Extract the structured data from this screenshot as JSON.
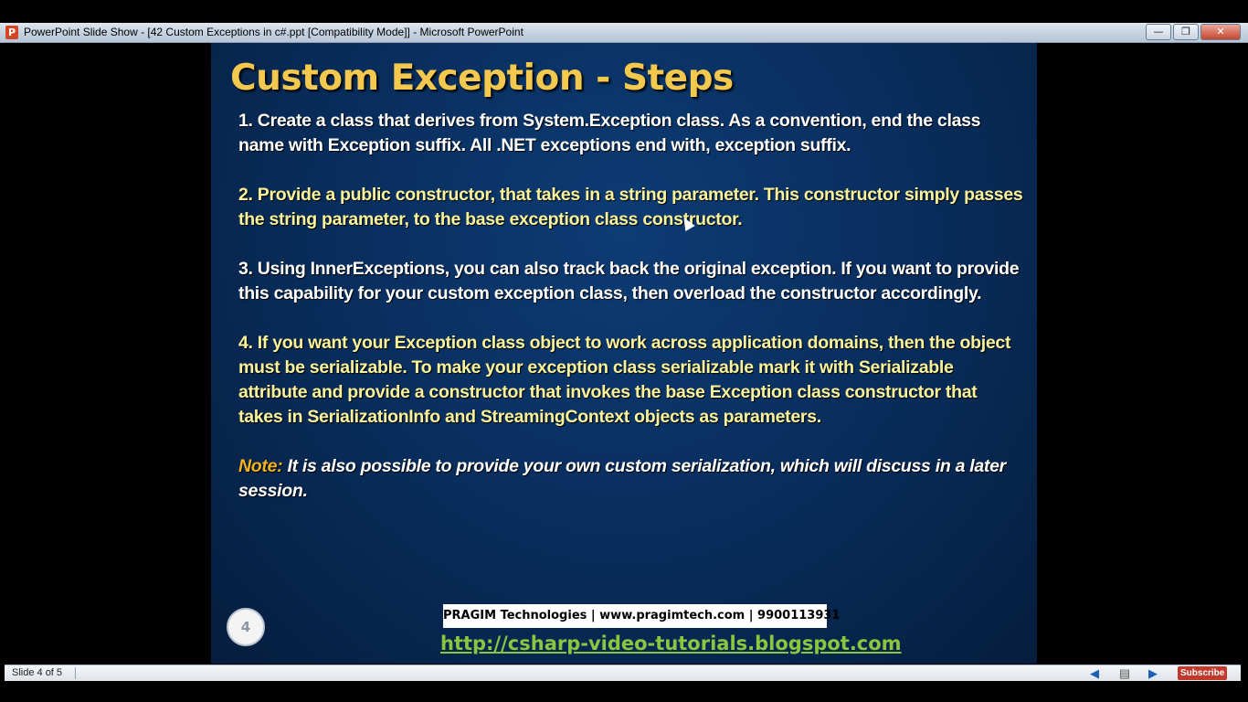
{
  "window": {
    "app_icon": "powerpoint-icon",
    "title": "PowerPoint Slide Show - [42 Custom Exceptions in c#.ppt [Compatibility Mode]] - Microsoft PowerPoint",
    "buttons": [
      "minimize-icon",
      "restore-icon",
      "close-icon"
    ]
  },
  "slide": {
    "title": "Custom Exception - Steps",
    "steps": [
      "1. Create a class that derives from System.Exception class. As a convention, end the class name with Exception suffix. All .NET exceptions end with,  exception suffix.",
      "2. Provide a public constructor, that takes in a string parameter. This constructor simply passes the string parameter, to the base exception class constructor.",
      "3. Using InnerExceptions, you can also track back the original exception. If you want to provide this capability for your custom exception class, then overload the constructor accordingly.",
      "4. If you want your Exception class object to work across application domains, then the object must be serializable. To make your exception class serializable mark it with Serializable attribute and provide a constructor that invokes the base Exception class constructor that takes in SerializationInfo and StreamingContext objects as parameters."
    ],
    "note_label": "Note:",
    "note_text": " It is also possible to provide your own custom serialization, which will discuss in a later session.",
    "slide_number": "4",
    "footer": "PRAGIM Technologies | www.pragimtech.com | 9900113931",
    "link": "http://csharp-video-tutorials.blogspot.com",
    "colors": {
      "title": "#f2c84e",
      "yellow_text": "#fbf39a",
      "note_label": "#f3b21f",
      "link": "#8cc63f",
      "background": "#082c5a"
    }
  },
  "statusbar": {
    "slide_indicator": "Slide 4 of 5",
    "subscribe_label": "Subscribe"
  }
}
